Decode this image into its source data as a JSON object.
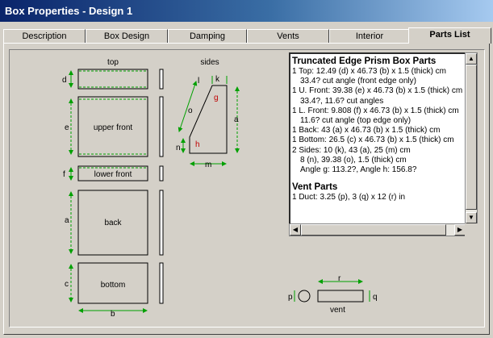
{
  "window": {
    "title": "Box Properties - Design 1"
  },
  "tabs": [
    {
      "label": "Description",
      "active": false
    },
    {
      "label": "Box Design",
      "active": false
    },
    {
      "label": "Damping",
      "active": false
    },
    {
      "label": "Vents",
      "active": false
    },
    {
      "label": "Interior",
      "active": false
    },
    {
      "label": "Parts List",
      "active": true
    }
  ],
  "diagram": {
    "top_label": "top",
    "sides_label": "sides",
    "panels": {
      "upper_front": "upper front",
      "lower_front": "lower front",
      "back": "back",
      "bottom": "bottom"
    },
    "dims": {
      "d": "d",
      "e": "e",
      "f": "f",
      "a": "a",
      "c": "c",
      "b": "b",
      "k": "k",
      "l": "l",
      "o": "o",
      "g": "g",
      "h": "h",
      "n": "n",
      "m": "m",
      "a2": "a"
    },
    "vent": {
      "label": "vent",
      "p": "p",
      "q": "q",
      "r": "r"
    }
  },
  "parts_list": {
    "title": "Truncated Edge Prism Box Parts",
    "lines": [
      {
        "text": "1 Top:  12.49 (d) x 46.73 (b) x 1.5 (thick) cm",
        "indent": false
      },
      {
        "text": "33.4? cut angle (front edge only)",
        "indent": true
      },
      {
        "text": "1 U. Front:  39.38 (e) x 46.73 (b) x 1.5 (thick) cm",
        "indent": false
      },
      {
        "text": "33.4?, 11.6? cut angles",
        "indent": true
      },
      {
        "text": "1 L. Front:  9.808 (f) x 46.73 (b) x 1.5 (thick) cm",
        "indent": false
      },
      {
        "text": "11.6? cut angle (top edge only)",
        "indent": true
      },
      {
        "text": "1 Back:  43 (a) x 46.73 (b) x 1.5 (thick) cm",
        "indent": false
      },
      {
        "text": "1 Bottom:  26.5 (c) x 46.73 (b) x 1.5 (thick) cm",
        "indent": false
      },
      {
        "text": "2 Sides:  10 (k), 43 (a), 25 (m) cm",
        "indent": false
      },
      {
        "text": "8 (n), 39.38 (o), 1.5 (thick) cm",
        "indent": true
      },
      {
        "text": "Angle g: 113.2?, Angle h: 156.8?",
        "indent": true
      }
    ],
    "vent_title": "Vent Parts",
    "vent_lines": [
      {
        "text": "1 Duct:  3.25 (p), 3 (q) x 12 (r) in"
      }
    ]
  },
  "colors": {
    "title_start": "#0a246a",
    "title_end": "#a6caf0",
    "dimension": "#00a000",
    "angle": "#c00000"
  }
}
